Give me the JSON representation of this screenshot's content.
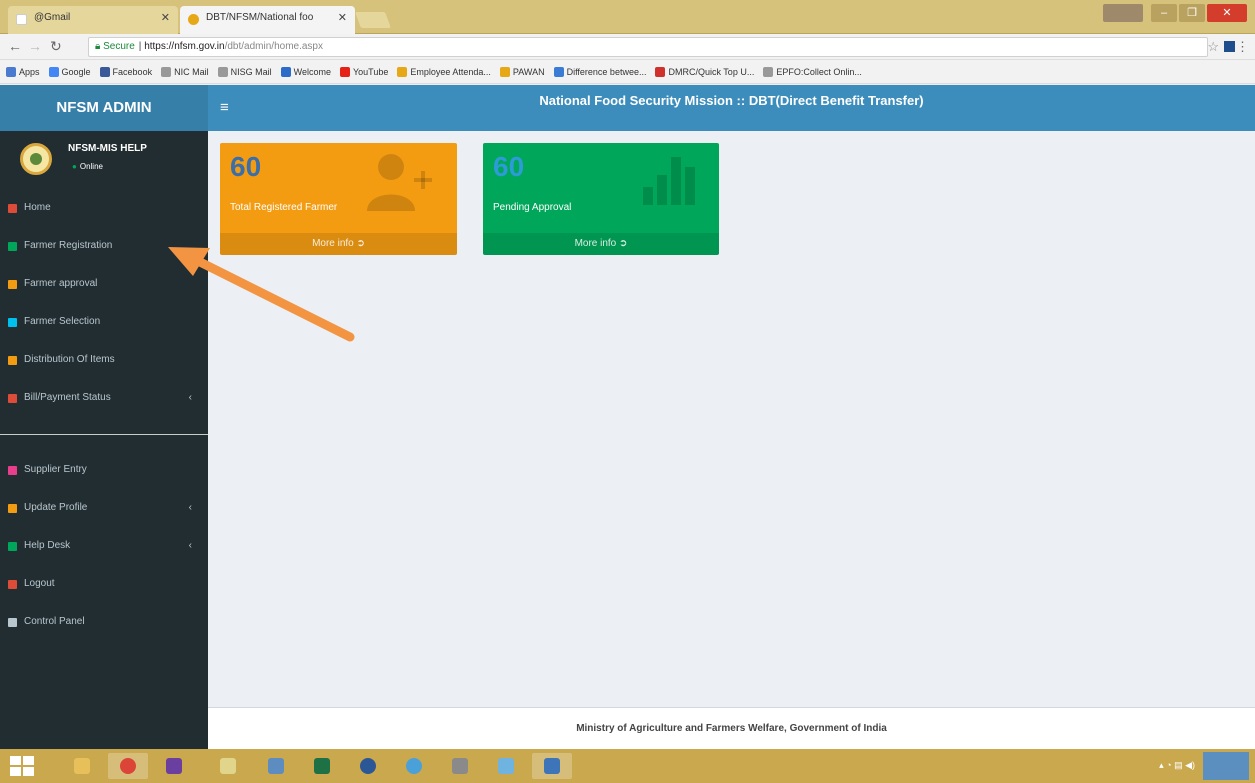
{
  "browser": {
    "tabs": [
      {
        "title": "@Gmail"
      },
      {
        "title": "DBT/NFSM/National foo"
      }
    ],
    "address": {
      "secure_label": "Secure",
      "host": "https://nfsm.gov.in",
      "path": "/dbt/admin/home.aspx"
    },
    "bookmarks": [
      {
        "label": "Apps",
        "color": "#4a7bd0"
      },
      {
        "label": "Google",
        "color": "#4285f4"
      },
      {
        "label": "Facebook",
        "color": "#3b5998"
      },
      {
        "label": "NIC Mail",
        "color": "#999999"
      },
      {
        "label": "NISG Mail",
        "color": "#999999"
      },
      {
        "label": "Welcome",
        "color": "#2a6cc7"
      },
      {
        "label": "YouTube",
        "color": "#e62117"
      },
      {
        "label": "Employee Attenda...",
        "color": "#e6a817"
      },
      {
        "label": "PAWAN",
        "color": "#e6a817"
      },
      {
        "label": "Difference betwee...",
        "color": "#3a7bd5"
      },
      {
        "label": "DMRC/Quick Top U...",
        "color": "#d0312d"
      },
      {
        "label": "EPFO:Collect Onlin...",
        "color": "#999999"
      }
    ]
  },
  "header": {
    "brand": "NFSM ADMIN",
    "title": "National Food Security Mission :: DBT(Direct Benefit Transfer)"
  },
  "user": {
    "name": "NFSM-MIS HELP",
    "status": "Online"
  },
  "sidebar": {
    "items": [
      {
        "label": "Home",
        "color": "#dd4b39",
        "has_submenu": false
      },
      {
        "label": "Farmer Registration",
        "color": "#00a65a",
        "has_submenu": false
      },
      {
        "label": "Farmer approval",
        "color": "#f39c12",
        "has_submenu": false
      },
      {
        "label": "Farmer Selection",
        "color": "#00c0ef",
        "has_submenu": false
      },
      {
        "label": "Distribution Of Items",
        "color": "#f39c12",
        "has_submenu": false
      },
      {
        "label": "Bill/Payment Status",
        "color": "#dd4b39",
        "has_submenu": true
      }
    ],
    "items2": [
      {
        "label": "Supplier Entry",
        "color": "#e83e8c",
        "has_submenu": false
      },
      {
        "label": "Update Profile",
        "color": "#f39c12",
        "has_submenu": true
      },
      {
        "label": "Help Desk",
        "color": "#00a65a",
        "has_submenu": true
      },
      {
        "label": "Logout",
        "color": "#dd4b39",
        "has_submenu": false
      },
      {
        "label": "Control Panel",
        "color": "#b8c7ce",
        "has_submenu": false
      }
    ],
    "submenu_chevron": "‹"
  },
  "boxes": [
    {
      "value": "60",
      "label": "Total Registered Farmer",
      "footer": "More info",
      "color": "#f39c12",
      "icon": "user-plus-icon"
    },
    {
      "value": "60",
      "label": "Pending Approval",
      "footer": "More info",
      "color": "#00a65a",
      "icon": "bar-chart-icon"
    }
  ],
  "footer": {
    "text": "Ministry of Agriculture and Farmers Welfare, Government of India"
  },
  "annotation": {
    "arrow_color": "#f39443"
  }
}
